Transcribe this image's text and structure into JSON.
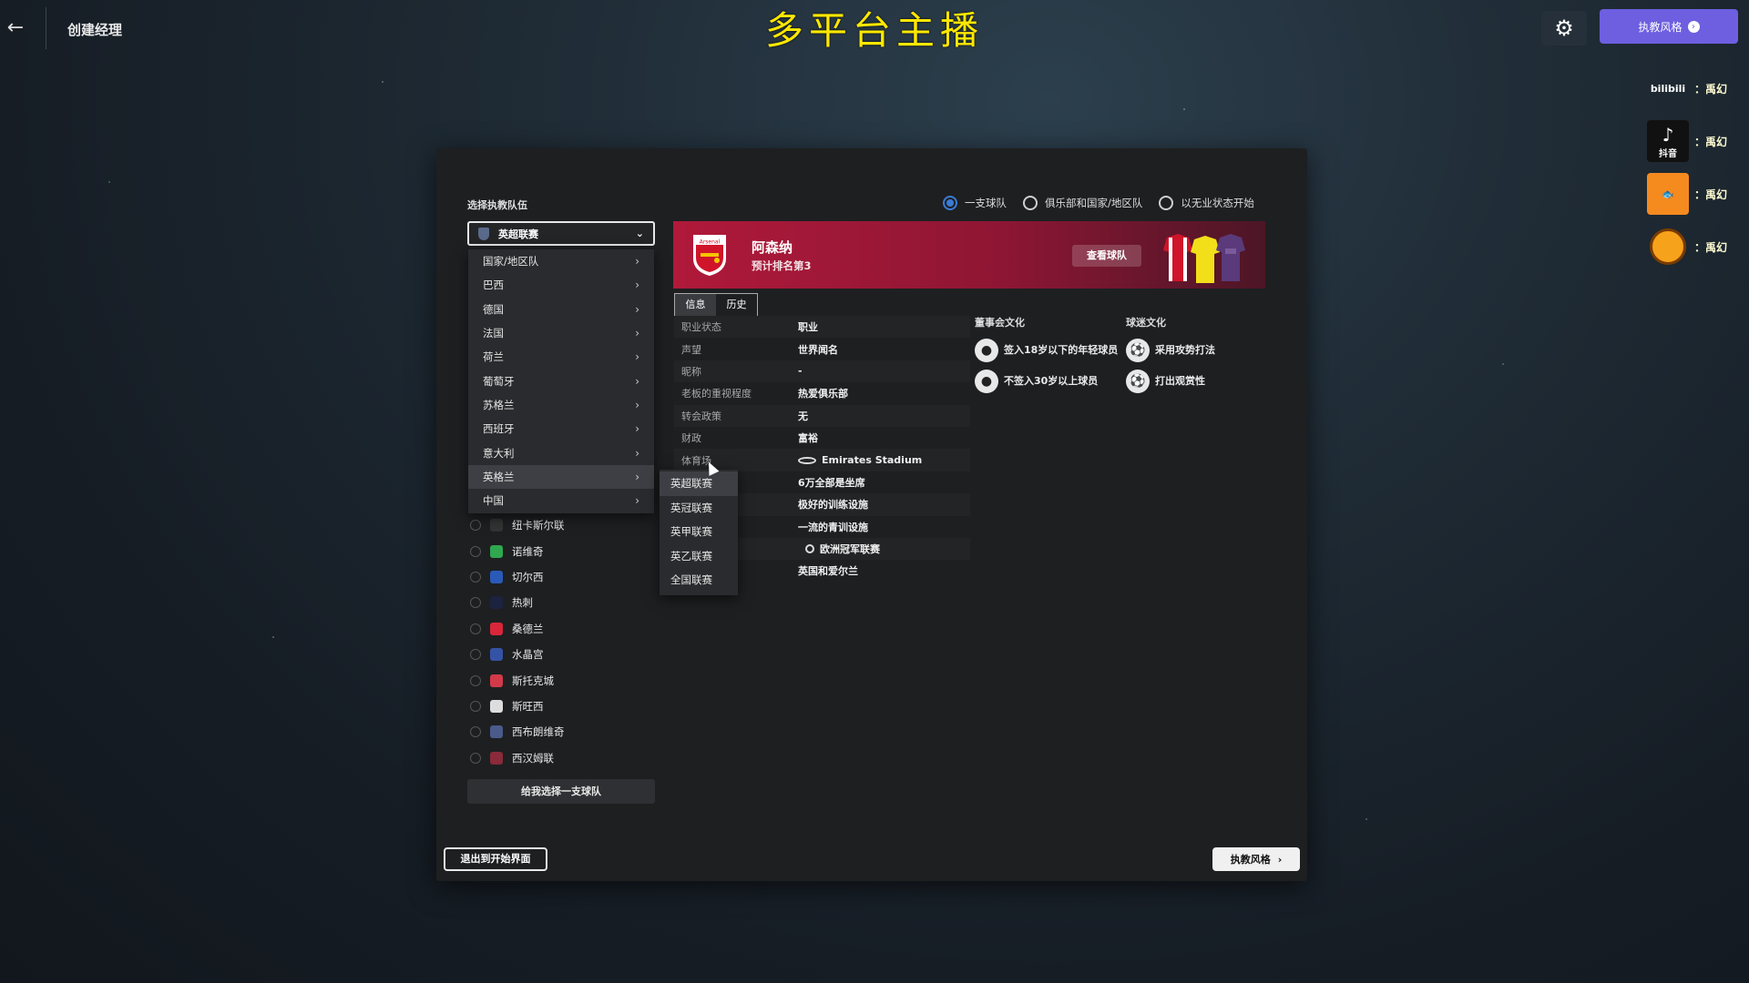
{
  "topbar": {
    "page_title": "创建经理",
    "banner": "多平台主播",
    "style_button": "执教风格"
  },
  "social": [
    {
      "logo": "bilibili",
      "logo_text": "bilibili",
      "name": "：禹幻"
    },
    {
      "logo": "douyin",
      "logo_text": "抖音",
      "name": "：禹幻"
    },
    {
      "logo": "douyu",
      "logo_text": "",
      "name": "：禹幻"
    },
    {
      "logo": "huya",
      "logo_text": "",
      "name": "：禹幻"
    }
  ],
  "panel": {
    "select_label": "选择执教队伍",
    "modes": [
      {
        "label": "一支球队",
        "selected": true
      },
      {
        "label": "俱乐部和国家/地区队",
        "selected": false
      },
      {
        "label": "以无业状态开始",
        "selected": false
      }
    ],
    "league_select": "英超联赛",
    "country_menu": [
      "国家/地区队",
      "巴西",
      "德国",
      "法国",
      "荷兰",
      "葡萄牙",
      "苏格兰",
      "西班牙",
      "意大利",
      "英格兰",
      "中国"
    ],
    "country_active": "英格兰",
    "sub_menu": [
      "英超联赛",
      "英冠联赛",
      "英甲联赛",
      "英乙联赛",
      "全国联赛"
    ],
    "sub_active": "英超联赛",
    "teams": [
      {
        "name": "纽卡斯尔联",
        "color": "#333333"
      },
      {
        "name": "诺维奇",
        "color": "#2fa84f"
      },
      {
        "name": "切尔西",
        "color": "#2a5ab8"
      },
      {
        "name": "热刺",
        "color": "#1b2340"
      },
      {
        "name": "桑德兰",
        "color": "#d9263a"
      },
      {
        "name": "水晶宫",
        "color": "#3553a6"
      },
      {
        "name": "斯托克城",
        "color": "#d23a4a"
      },
      {
        "name": "斯旺西",
        "color": "#dddddd"
      },
      {
        "name": "西布朗维奇",
        "color": "#4a5a8a"
      },
      {
        "name": "西汉姆联",
        "color": "#8a2a3a"
      }
    ],
    "pick_button": "给我选择一支球队",
    "exit_button": "退出到开始界面",
    "style_button": "执教风格"
  },
  "club": {
    "name": "阿森纳",
    "predicted": "预计排名第3",
    "view_button": "查看球队",
    "crest_text": "Arsenal",
    "brand_color": "#b0193a"
  },
  "tabs": [
    "信息",
    "历史"
  ],
  "info": [
    {
      "k": "职业状态",
      "v": "职业"
    },
    {
      "k": "声望",
      "v": "世界闻名"
    },
    {
      "k": "昵称",
      "v": "-"
    },
    {
      "k": "老板的重视程度",
      "v": "热爱俱乐部"
    },
    {
      "k": "转会政策",
      "v": "无"
    },
    {
      "k": "财政",
      "v": "富裕"
    },
    {
      "k": "体育场",
      "v": "Emirates Stadium",
      "icon": "stadium-icon"
    },
    {
      "k": "",
      "v": "6万全部是坐席"
    },
    {
      "k": "",
      "v": "极好的训练设施"
    },
    {
      "k": "",
      "v": "一流的青训设施"
    },
    {
      "k": "",
      "v": "欧洲冠军联赛",
      "icon": "ucl-icon"
    },
    {
      "k": "",
      "v": "英国和爱尔兰"
    }
  ],
  "board_culture": {
    "title": "董事会文化",
    "items": [
      "签入18岁以下的年轻球员",
      "不签入30岁以上球员"
    ]
  },
  "fan_culture": {
    "title": "球迷文化",
    "items": [
      "采用攻势打法",
      "打出观赏性"
    ]
  }
}
